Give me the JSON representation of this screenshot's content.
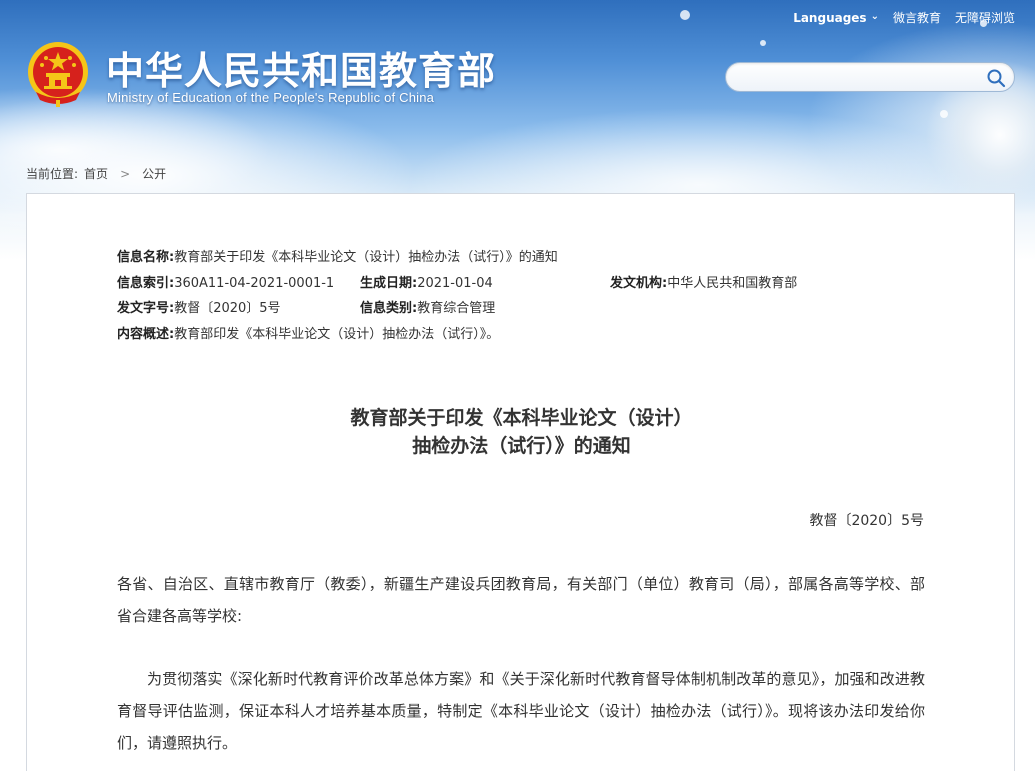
{
  "header": {
    "title_cn": "中华人民共和国教育部",
    "title_en": "Ministry of Education of the People's Republic of China",
    "links": {
      "languages": "Languages",
      "weibo": "微言教育",
      "accessibility": "无障碍浏览"
    },
    "search": {
      "value": "",
      "placeholder": ""
    }
  },
  "breadcrumb": {
    "prefix": "当前位置:",
    "items": [
      "首页",
      "公开"
    ]
  },
  "meta": {
    "name_label": "信息名称:",
    "name_value": "教育部关于印发《本科毕业论文（设计）抽检办法（试行）》的通知",
    "index_label": "信息索引:",
    "index_value": "360A11-04-2021-0001-1",
    "date_label": "生成日期:",
    "date_value": "2021-01-04",
    "issuer_label": "发文机构:",
    "issuer_value": "中华人民共和国教育部",
    "docno_label": "发文字号:",
    "docno_value": "教督〔2020〕5号",
    "category_label": "信息类别:",
    "category_value": "教育综合管理",
    "summary_label": "内容概述:",
    "summary_value": "教育部印发《本科毕业论文（设计）抽检办法（试行）》。"
  },
  "document": {
    "title_line1": "教育部关于印发《本科毕业论文（设计）",
    "title_line2": "抽检办法（试行）》的通知",
    "doc_number": "教督〔2020〕5号",
    "paragraph1": "各省、自治区、直辖市教育厅（教委），新疆生产建设兵团教育局，有关部门（单位）教育司（局），部属各高等学校、部省合建各高等学校:",
    "paragraph2": "为贯彻落实《深化新时代教育评价改革总体方案》和《关于深化新时代教育督导体制机制改革的意见》，加强和改进教育督导评估监测，保证本科人才培养基本质量，特制定《本科毕业论文（设计）抽检办法（试行）》。现将该办法印发给你们，请遵照执行。"
  },
  "colors": {
    "sky_top": "#2f6fbd",
    "emblem_red": "#d6211c",
    "emblem_gold": "#f5c518"
  }
}
